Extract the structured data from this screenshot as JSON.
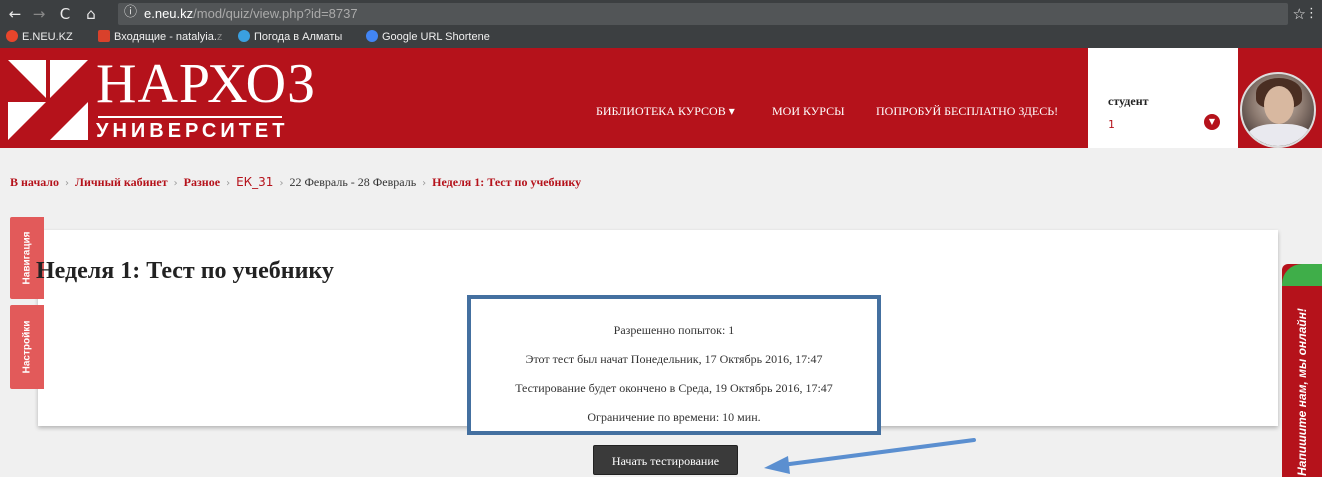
{
  "browser": {
    "url_host": "e.neu.kz",
    "url_path": "/mod/quiz/view.php?id=8737",
    "bookmarks": [
      {
        "label": "E.NEU.KZ",
        "color": "#e8452b"
      },
      {
        "label": "Входящие - natalyia.",
        "fade": "z",
        "color": "#d9412b"
      },
      {
        "label": "Погода в Алматы",
        "color": "#3aa0e0"
      },
      {
        "label": "Google URL Shortene",
        "color": "#4285f4"
      }
    ]
  },
  "header": {
    "logo_title": "НАРХОЗ",
    "logo_sub": "УНИВЕРСИТЕТ",
    "menu": [
      {
        "label": "БИБЛИОТЕКА КУРСОВ ▾"
      },
      {
        "label": "МОИ КУРСЫ"
      },
      {
        "label": "ПОПРОБУЙ БЕСПЛАТНО ЗДЕСЬ!"
      }
    ],
    "user_name": "студент",
    "user_number": "1"
  },
  "breadcrumb": {
    "items": [
      "В начало",
      "Личный кабинет",
      "Разное",
      "ЕК_31",
      "22 Февраль - 28 Февраль",
      "Неделя 1: Тест по учебнику"
    ]
  },
  "sidetabs": {
    "navigation": "Навигация",
    "settings": "Настройки"
  },
  "page": {
    "title": "Неделя 1: Тест по учебнику",
    "info": [
      "Разрешенно попыток: 1",
      "Этот тест был начат Понедельник, 17 Октябрь 2016, 17:47",
      "Тестирование будет окончено в Среда, 19 Октябрь 2016, 17:47",
      "Ограничение по времени: 10 мин."
    ],
    "start_button": "Начать тестирование"
  },
  "chat": {
    "label": "Напишите нам, мы онлайн!"
  },
  "colors": {
    "brand_red": "#b5121b",
    "highlight_box": "#4470a0",
    "arrow": "#5b8fd0"
  }
}
